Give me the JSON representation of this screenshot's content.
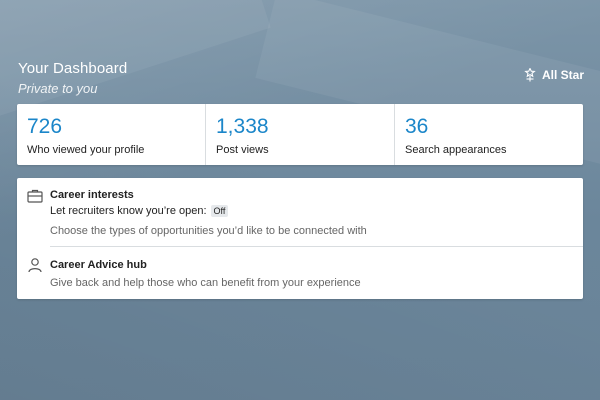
{
  "header": {
    "title": "Your Dashboard",
    "subtitle": "Private to you",
    "badge_label": "All Star"
  },
  "stats": [
    {
      "value": "726",
      "label": "Who viewed your profile"
    },
    {
      "value": "1,338",
      "label": "Post views"
    },
    {
      "value": "36",
      "label": "Search appearances"
    }
  ],
  "career_interests": {
    "title": "Career interests",
    "open_text": "Let recruiters know you’re open:",
    "status": "Off",
    "description": "Choose the types of opportunities you’d like to be connected with",
    "icon": "briefcase-icon"
  },
  "career_advice": {
    "title": "Career Advice hub",
    "description": "Give back and help those who can benefit from your experience",
    "icon": "person-icon"
  },
  "colors": {
    "accent": "#1b86c9",
    "background": "#6f8a9f"
  }
}
